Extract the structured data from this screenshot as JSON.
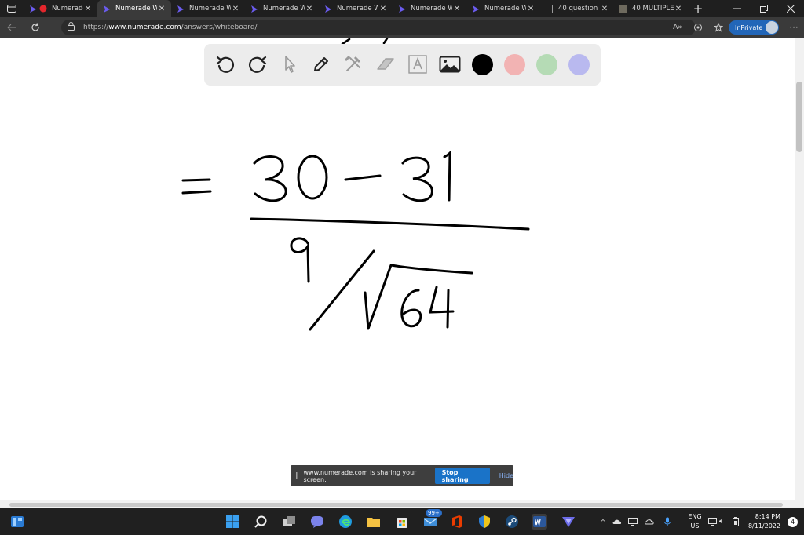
{
  "browser": {
    "tabs": [
      {
        "title": "Numerade",
        "active": false,
        "recording": true
      },
      {
        "title": "Numerade W",
        "active": true
      },
      {
        "title": "Numerade W",
        "active": false
      },
      {
        "title": "Numerade W",
        "active": false
      },
      {
        "title": "Numerade W",
        "active": false
      },
      {
        "title": "Numerade W",
        "active": false
      },
      {
        "title": "Numerade W",
        "active": false
      },
      {
        "title": "40 question",
        "active": false
      },
      {
        "title": "40 MULTIPLE",
        "active": false
      }
    ],
    "url_prefix": "https://",
    "url_host": "www.numerade.com",
    "url_path": "/answers/whiteboard/",
    "inprivate_label": "InPrivate"
  },
  "whiteboard": {
    "tools": [
      "undo-icon",
      "redo-icon",
      "pointer-icon",
      "pen-icon",
      "tools-icon",
      "eraser-icon",
      "text-icon",
      "image-icon"
    ],
    "colors": [
      "#000000",
      "#f2b3b3",
      "#b5dbb5",
      "#b9b9ef"
    ],
    "handwriting": {
      "equals": "=",
      "numerator": "30 − 31",
      "denominator_index": "9",
      "radicand": "64"
    }
  },
  "share_banner": {
    "message": "www.numerade.com is sharing your screen.",
    "stop_label": "Stop sharing",
    "hide_label": "Hide"
  },
  "taskbar": {
    "badge": "99+",
    "lang_line1": "ENG",
    "lang_line2": "US",
    "time": "8:14 PM",
    "date": "8/11/2022",
    "notifications": "4"
  }
}
